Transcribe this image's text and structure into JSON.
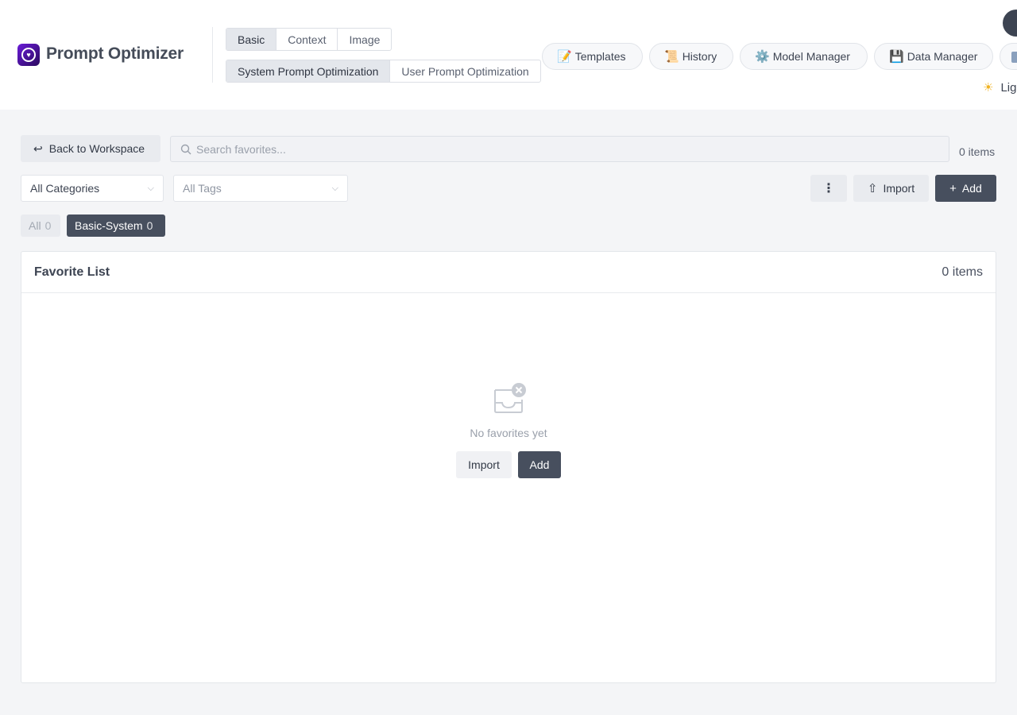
{
  "app": {
    "title": "Prompt Optimizer",
    "logo_icon": "heart-shield-logo",
    "accent": "#6a1bd8"
  },
  "mode_tabs": [
    {
      "label": "Basic",
      "active": true
    },
    {
      "label": "Context",
      "active": false
    },
    {
      "label": "Image",
      "active": false
    }
  ],
  "optimization_tabs": [
    {
      "label": "System Prompt Optimization",
      "active": true
    },
    {
      "label": "User Prompt Optimization",
      "active": false
    }
  ],
  "nav": {
    "templates": {
      "icon": "📝",
      "label": "Templates"
    },
    "history": {
      "icon": "📜",
      "label": "History"
    },
    "model_manager": {
      "icon": "⚙️",
      "label": "Model Manager"
    },
    "data_manager": {
      "icon": "💾",
      "label": "Data Manager"
    }
  },
  "theme": {
    "icon": "☀",
    "label": "Lig"
  },
  "toolbar": {
    "back_label": "Back to Workspace",
    "search_placeholder": "Search favorites...",
    "items_count": "0 items",
    "category_select": "All Categories",
    "tag_select": "All Tags",
    "more_icon": "⋮",
    "import_label": "Import",
    "add_label": "Add"
  },
  "filter_chips": [
    {
      "label": "All",
      "count": "0",
      "active": false
    },
    {
      "label": "Basic-System",
      "count": "0",
      "active": true
    }
  ],
  "favorites": {
    "title": "Favorite List",
    "count": "0 items",
    "empty_text": "No favorites yet",
    "empty_import": "Import",
    "empty_add": "Add"
  },
  "colors": {
    "primary_dark": "#474f5e",
    "background": "#f4f5f7",
    "theme_sun": "#f0b323"
  }
}
